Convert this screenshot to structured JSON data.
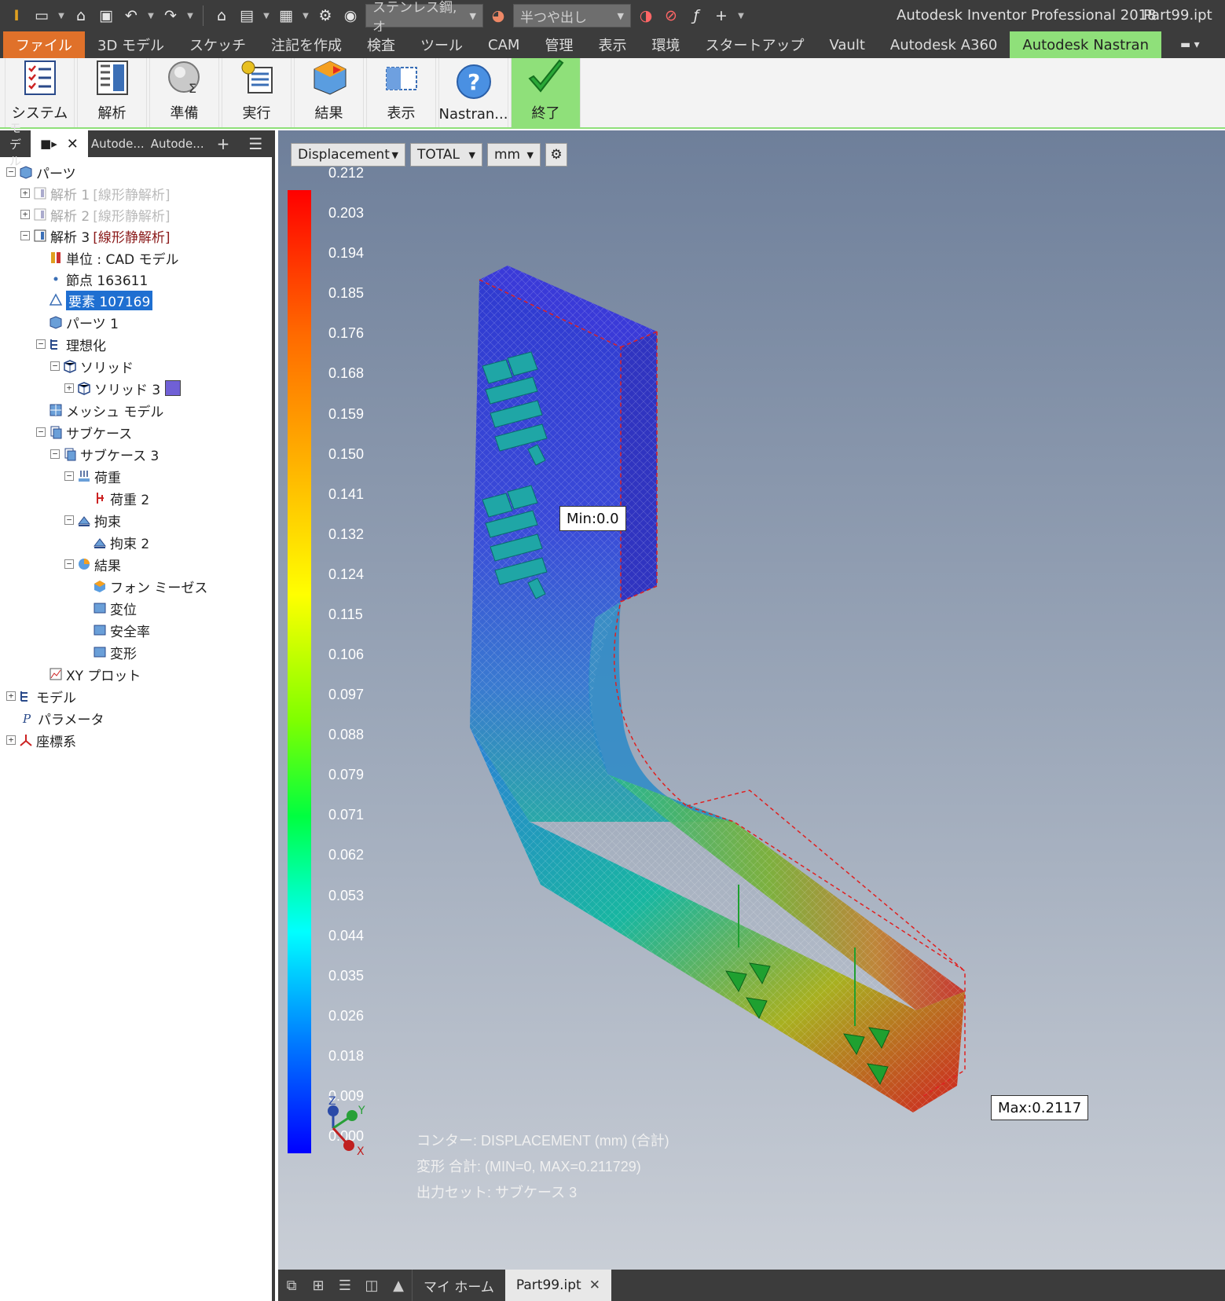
{
  "titlebar": {
    "app_title": "Autodesk Inventor Professional 2018",
    "file_name": "Part99.ipt",
    "material": "ステンレス鋼, オ",
    "appearance": "半つや出し"
  },
  "menu": {
    "tabs": [
      "ファイル",
      "3D モデル",
      "スケッチ",
      "注記を作成",
      "検査",
      "ツール",
      "CAM",
      "管理",
      "表示",
      "環境",
      "スタートアップ",
      "Vault",
      "Autodesk A360",
      "Autodesk Nastran"
    ]
  },
  "ribbon": {
    "buttons": [
      "システム",
      "解析",
      "準備",
      "実行",
      "結果",
      "表示",
      "Nastran...",
      "終了"
    ]
  },
  "browser": {
    "tabs": [
      "モデル",
      "Autode...",
      "Autode..."
    ],
    "tree": {
      "parts": "パーツ",
      "analysis1": "解析 1",
      "analysis1_tag": "[線形静解析]",
      "analysis2": "解析 2",
      "analysis2_tag": "[線形静解析]",
      "analysis3": "解析 3",
      "analysis3_tag": "[線形静解析]",
      "units": "単位 : CAD モデル",
      "nodes": "節点 163611",
      "elements": "要素 107169",
      "parts1": "パーツ 1",
      "idealization": "理想化",
      "solid": "ソリッド",
      "solid3": "ソリッド 3",
      "mesh_model": "メッシュ モデル",
      "subcase": "サブケース",
      "subcase3": "サブケース 3",
      "load": "荷重",
      "load2": "荷重 2",
      "constraint": "拘束",
      "constraint2": "拘束 2",
      "results": "結果",
      "von_mises": "フォン ミーゼス",
      "displacement": "変位",
      "safety_factor": "安全率",
      "deformation": "変形",
      "xy_plot": "XY プロット",
      "model": "モデル",
      "parameters": "パラメータ",
      "coord_system": "座標系"
    }
  },
  "viewport": {
    "result_type": "Displacement",
    "component": "TOTAL",
    "unit": "mm",
    "scale_values": [
      "0.212",
      "0.203",
      "0.194",
      "0.185",
      "0.176",
      "0.168",
      "0.159",
      "0.150",
      "0.141",
      "0.132",
      "0.124",
      "0.115",
      "0.106",
      "0.097",
      "0.088",
      "0.079",
      "0.071",
      "0.062",
      "0.053",
      "0.044",
      "0.035",
      "0.026",
      "0.018",
      "0.009",
      "0.000"
    ],
    "min_label": "Min:0.0",
    "max_label": "Max:0.2117",
    "info_lines": [
      "コンター: DISPLACEMENT (mm) (合計)",
      "変形 合計: (MIN=0, MAX=0.211729)",
      "出力セット: サブケース 3"
    ],
    "triad": {
      "z": "Z",
      "y": "Y",
      "x": "X"
    }
  },
  "bottom": {
    "tabs": [
      "マイ ホーム",
      "Part99.ipt"
    ],
    "close_glyph": "✕"
  },
  "colors": {
    "accent_file": "#e0712a",
    "accent_nastran": "#8fe07a",
    "selection": "#1f6fd1"
  }
}
